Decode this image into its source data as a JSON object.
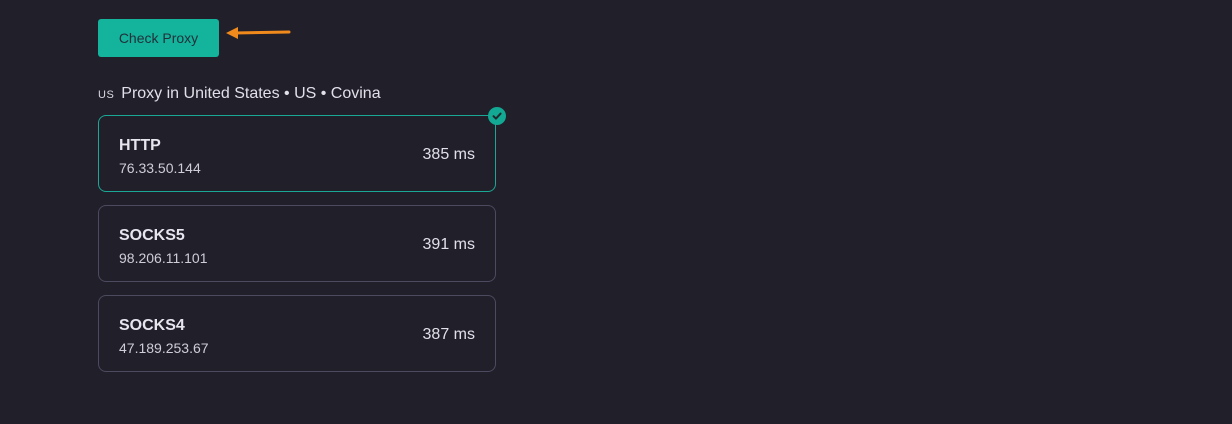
{
  "check_button": {
    "label": "Check Proxy"
  },
  "header": {
    "flag": "US",
    "text": "Proxy in United States • US • Covina"
  },
  "proxies": [
    {
      "type": "HTTP",
      "ip": "76.33.50.144",
      "latency": "385 ms",
      "selected": true
    },
    {
      "type": "SOCKS5",
      "ip": "98.206.11.101",
      "latency": "391 ms",
      "selected": false
    },
    {
      "type": "SOCKS4",
      "ip": "47.189.253.67",
      "latency": "387 ms",
      "selected": false
    }
  ],
  "colors": {
    "background": "#211f2a",
    "accent": "#13b39c",
    "arrow": "#f08a1c",
    "card_border": "#4c4a5e"
  }
}
